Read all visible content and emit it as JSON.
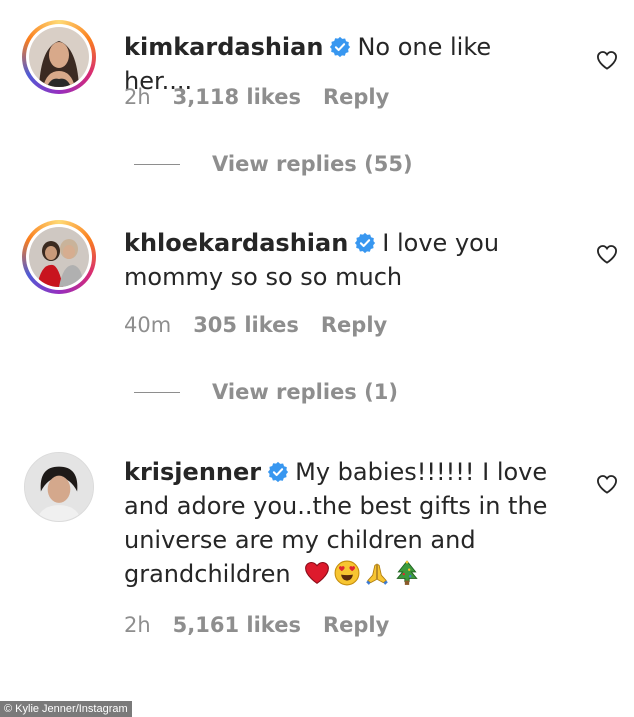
{
  "comments": [
    {
      "username": "kimkardashian",
      "text": "No one like her....",
      "time": "2h",
      "likes": "3,118 likes",
      "reply": "Reply",
      "view_replies": "View replies (55)"
    },
    {
      "username": "khloekardashian",
      "text_line1": "I love you",
      "text_line2": "mommy so so so much",
      "time": "40m",
      "likes": "305 likes",
      "reply": "Reply",
      "view_replies": "View replies (1)"
    },
    {
      "username": "krisjenner",
      "text_line1": "My babies!!!!!! I love",
      "text_line2": "and adore you..the best gifts in the",
      "text_line3": "universe are my children and",
      "text_line4": "grandchildren",
      "emojis": [
        "red-heart",
        "heart-eyes",
        "folded-hands",
        "christmas-tree"
      ],
      "time": "2h",
      "likes": "5,161 likes",
      "reply": "Reply"
    }
  ],
  "credit": "© Kylie Jenner/Instagram",
  "colors": {
    "text": "#262626",
    "meta": "#8e8e8e",
    "verified": "#3897f0"
  }
}
